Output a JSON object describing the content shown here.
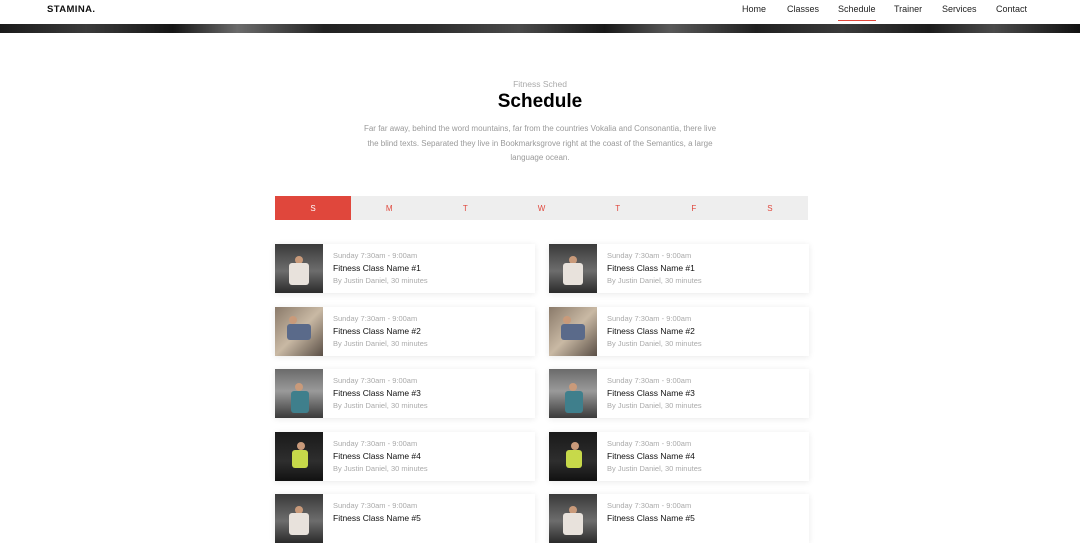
{
  "header": {
    "logo": "STAMINA.",
    "nav": [
      "Home",
      "Classes",
      "Schedule",
      "Trainer",
      "Services",
      "Contact"
    ],
    "active_nav": "Schedule"
  },
  "section": {
    "eyebrow": "Fitness Sched",
    "title": "Schedule",
    "description": "Far far away, behind the word mountains, far from the countries Vokalia and Consonantia, there live the blind texts. Separated they live in Bookmarksgrove right at the coast of the Semantics, a large language ocean."
  },
  "days": [
    "S",
    "M",
    "T",
    "W",
    "T",
    "F",
    "S"
  ],
  "active_day_index": 0,
  "classes": {
    "left": [
      {
        "time": "Sunday 7:30am - 9:00am",
        "name": "Fitness Class Name #1",
        "by": "By Justin Daniel, 30 minutes",
        "photo": "gym-photo-back-lift"
      },
      {
        "time": "Sunday 7:30am - 9:00am",
        "name": "Fitness Class Name #2",
        "by": "By Justin Daniel, 30 minutes",
        "photo": "gym-photo-battle-rope"
      },
      {
        "time": "Sunday 7:30am - 9:00am",
        "name": "Fitness Class Name #3",
        "by": "By Justin Daniel, 30 minutes",
        "photo": "gym-photo-squat"
      },
      {
        "time": "Sunday 7:30am - 9:00am",
        "name": "Fitness Class Name #4",
        "by": "By Justin Daniel, 30 minutes",
        "photo": "gym-photo-dumbbell"
      },
      {
        "time": "Sunday 7:30am - 9:00am",
        "name": "Fitness Class Name #5",
        "by": "",
        "photo": "gym-photo-back-lift"
      }
    ],
    "right": [
      {
        "time": "Sunday 7:30am - 9:00am",
        "name": "Fitness Class Name #1",
        "by": "By Justin Daniel, 30 minutes",
        "photo": "gym-photo-back-lift"
      },
      {
        "time": "Sunday 7:30am - 9:00am",
        "name": "Fitness Class Name #2",
        "by": "By Justin Daniel, 30 minutes",
        "photo": "gym-photo-battle-rope"
      },
      {
        "time": "Sunday 7:30am - 9:00am",
        "name": "Fitness Class Name #3",
        "by": "By Justin Daniel, 30 minutes",
        "photo": "gym-photo-squat"
      },
      {
        "time": "Sunday 7:30am - 9:00am",
        "name": "Fitness Class Name #4",
        "by": "By Justin Daniel, 30 minutes",
        "photo": "gym-photo-dumbbell"
      },
      {
        "time": "Sunday 7:30am - 9:00am",
        "name": "Fitness Class Name #5",
        "by": "",
        "photo": "gym-photo-back-lift"
      }
    ]
  },
  "colors": {
    "accent": "#e0473c",
    "tab_bg": "#eeeeee",
    "muted_text": "#aaaaaa"
  }
}
